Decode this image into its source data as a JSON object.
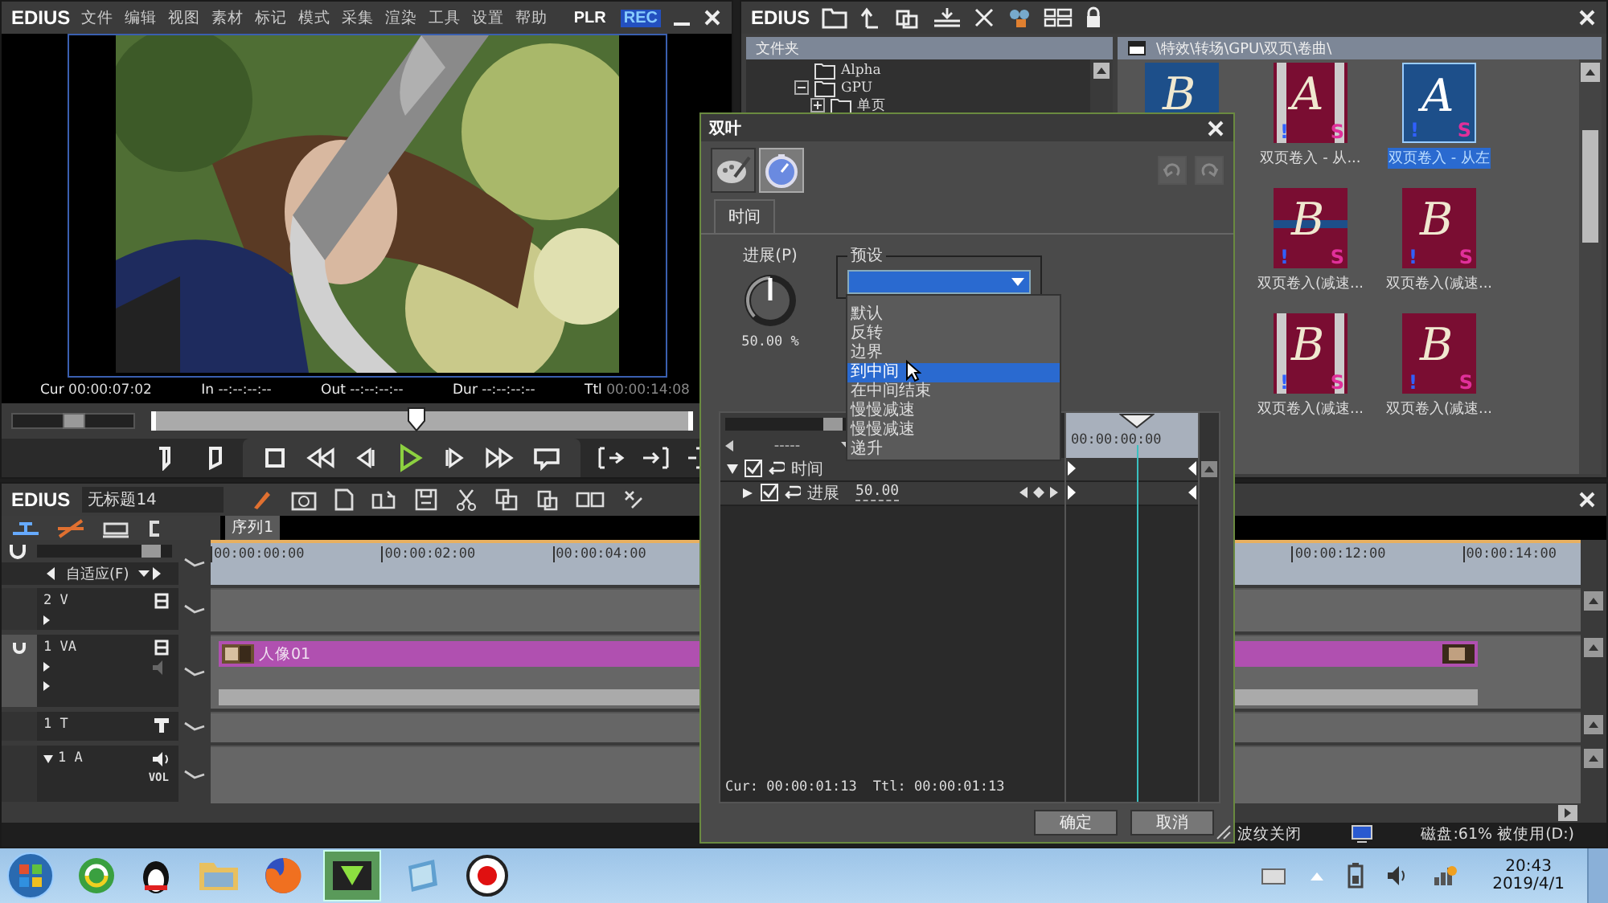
{
  "player": {
    "brand": "EDIUS",
    "menu": [
      "文件",
      "编辑",
      "视图",
      "素材",
      "标记",
      "模式",
      "采集",
      "渲染",
      "工具",
      "设置",
      "帮助"
    ],
    "modes": [
      {
        "label": "PLR",
        "selected": false
      },
      {
        "label": "REC",
        "selected": true
      }
    ],
    "timecodes": [
      {
        "label": "Cur",
        "value": "00:00:07:02",
        "dim": false
      },
      {
        "label": "In",
        "value": "--:--:--:--",
        "dim": false
      },
      {
        "label": "Out",
        "value": "--:--:--:--",
        "dim": false
      },
      {
        "label": "Dur",
        "value": "--:--:--:--",
        "dim": false
      },
      {
        "label": "Ttl",
        "value": "00:00:14:08",
        "dim": true
      }
    ],
    "speed": {
      "level": 0.5
    },
    "position": {
      "level": 0.49
    }
  },
  "bin": {
    "brand": "EDIUS",
    "folder_header": "文件夹",
    "tree": [
      {
        "label": "Alpha"
      },
      {
        "label": "GPU",
        "expanded": true,
        "children": [
          {
            "label": "单页",
            "expanded": false
          }
        ]
      }
    ],
    "path": "\\特效\\转场\\GPU\\双页\\卷曲\\",
    "tiles": [
      [
        {
          "kind": "curl",
          "letter": "B",
          "selected": false
        },
        {
          "kind": "split",
          "letter": "A",
          "flag": "!",
          "badge": "S",
          "caption": "双页卷入 - 从...",
          "selected": false
        },
        {
          "kind": "blue",
          "letter": "A",
          "flag": "!",
          "badge": "S",
          "caption": "双页卷入 - 从左",
          "selected": true
        }
      ],
      [
        {
          "kind": "band",
          "letter": "B",
          "flag": "!",
          "badge": "S",
          "caption": "双页卷入(减速...",
          "selected": false
        },
        {
          "kind": "plain",
          "letter": "B",
          "flag": "!",
          "badge": "S",
          "caption": "双页卷入(减速...",
          "selected": false
        }
      ],
      [
        {
          "kind": "split",
          "letter": "B",
          "flag": "!",
          "badge": "S",
          "caption": "双页卷入(减速...",
          "selected": false
        },
        {
          "kind": "arrow",
          "letter": "B",
          "flag": "!",
          "badge": "S",
          "caption": "双页卷入(减速...",
          "selected": false
        }
      ]
    ]
  },
  "timeline": {
    "brand": "EDIUS",
    "project": "无标题14",
    "sequences": [
      {
        "label": "序列1",
        "selected": true
      }
    ],
    "zoom": {
      "level": 0.9
    },
    "fit": "自适应(F)",
    "ruler_left": [
      "00:00:00:00",
      "00:00:02:00",
      "00:00:04:00"
    ],
    "ruler_right": [
      "00:00:12:00",
      "00:00:14:00"
    ],
    "tracks": [
      {
        "kind": "v",
        "label": "2 V"
      },
      {
        "kind": "va",
        "label": "1 VA",
        "clip": "人像01"
      },
      {
        "kind": "t",
        "label": "1 T"
      },
      {
        "kind": "a",
        "label": "1 A",
        "vol": "VOL"
      }
    ],
    "status": [
      "波纹关闭",
      "磁盘:61% 被使用(D:)"
    ]
  },
  "dialog": {
    "title": "双叶",
    "tools": [
      {
        "kind": "palette",
        "selected": false
      },
      {
        "kind": "stopwatch",
        "selected": true
      }
    ],
    "history": [
      {
        "kind": "undo",
        "disabled": true
      },
      {
        "kind": "redo",
        "disabled": true
      }
    ],
    "tabs": [
      {
        "label": "时间",
        "selected": true
      }
    ],
    "knob": {
      "label": "进展(P)",
      "value": "50.00 %",
      "level": 0.5
    },
    "preset": {
      "label": "预设",
      "options": [
        {
          "label": "默认",
          "selected": false
        },
        {
          "label": "反转",
          "selected": false
        },
        {
          "label": "边界",
          "selected": false
        },
        {
          "label": "到中间",
          "selected": true
        },
        {
          "label": "在中间结束",
          "selected": false
        },
        {
          "label": "慢慢减速",
          "selected": false
        },
        {
          "label": "慢慢减速",
          "selected": false
        },
        {
          "label": "递升",
          "selected": false
        }
      ]
    },
    "keyframes": {
      "zoom": {
        "level": 0.85
      },
      "interpolation": "-----",
      "timecode": "00:00:00:00",
      "rows": [
        {
          "label": "时间",
          "checked": true,
          "expanded": true,
          "children": [
            {
              "label": "进展",
              "value": "50.00",
              "checked": true,
              "expanded": false
            }
          ]
        }
      ],
      "cur": "Cur: 00:00:01:13",
      "ttl": "Ttl: 00:00:01:13"
    },
    "buttons": [
      "确定",
      "取消"
    ]
  },
  "taskbar": {
    "apps": [
      {
        "kind": "start"
      },
      {
        "kind": "guard"
      },
      {
        "kind": "penguin"
      },
      {
        "kind": "folder"
      },
      {
        "kind": "browser"
      },
      {
        "kind": "media"
      },
      {
        "kind": "notes"
      },
      {
        "kind": "record"
      }
    ],
    "time": "20:43",
    "date": "2019/4/1"
  }
}
